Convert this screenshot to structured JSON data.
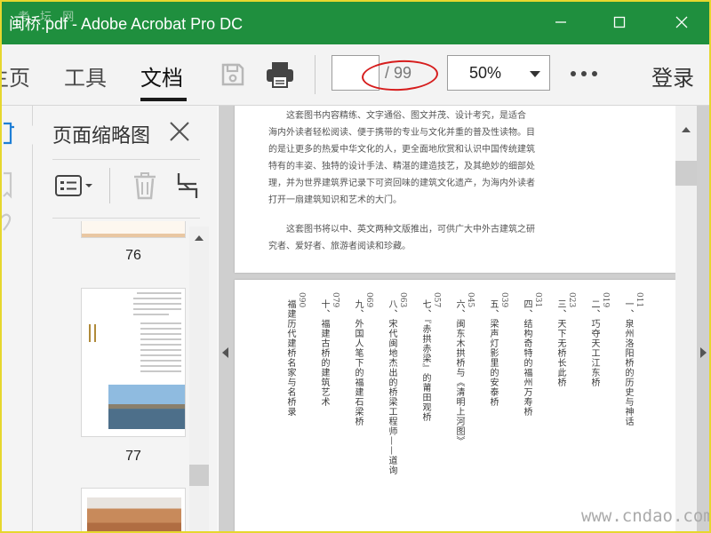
{
  "window": {
    "title": "闽桥.pdf - Adobe Acrobat Pro DC",
    "watermark": "考 坛 网"
  },
  "toolbar": {
    "tabs": [
      {
        "label": "主页"
      },
      {
        "label": "工具"
      },
      {
        "label": "文档",
        "active": true
      }
    ],
    "page_current": "",
    "page_total": "/ 99",
    "zoom": "50%",
    "login": "登录"
  },
  "thumbnail_panel": {
    "title": "页面缩略图",
    "thumbs": [
      {
        "label": "76"
      },
      {
        "label": "77"
      }
    ]
  },
  "document": {
    "page1_paragraphs": [
      "这套图书内容精练、文字通俗、图文并茂、设计考究，是适合",
      "海内外读者轻松阅读、便于携带的专业与文化并重的普及性读物。目",
      "的是让更多的热爱中华文化的人，更全面地欣赏和认识中国传统建筑",
      "特有的丰姿、独特的设计手法、精湛的建造技艺，及其绝妙的细部处",
      "理，并为世界建筑界记录下可资回味的建筑文化遗产，为海内外读者",
      "打开一扇建筑知识和艺术的大门。"
    ],
    "page1_paragraph2": [
      "这套图书将以中、英文两种文版推出，可供广大中外古建筑之研",
      "究者、爱好者、旅游者阅读和珍藏。"
    ],
    "toc": [
      {
        "num": "011",
        "title": "一、泉州洛阳桥的历史与神话"
      },
      {
        "num": "019",
        "title": "二、巧夺天工江东桥"
      },
      {
        "num": "023",
        "title": "三、天下无桥长此桥"
      },
      {
        "num": "031",
        "title": "四、结构奇特的福州万寿桥"
      },
      {
        "num": "039",
        "title": "五、梁声灯影里的安泰桥"
      },
      {
        "num": "045",
        "title": "六、闽东木拱桥与《清明上河图》"
      },
      {
        "num": "057",
        "title": "七、『赤拱赤梁』的莆田观桥"
      },
      {
        "num": "063",
        "title": "八、宋代闽地杰出的桥梁工程师——道询"
      },
      {
        "num": "069",
        "title": "九、外国人笔下的福建石梁桥"
      },
      {
        "num": "079",
        "title": "十、福建古桥的建筑艺术"
      },
      {
        "num": "090",
        "title": "福建历代建桥名家与名桥录"
      }
    ]
  },
  "site_watermark": "www.cndao.com",
  "colors": {
    "titlebar": "#1f8f3e",
    "annotation_oval": "#d61d1d",
    "frame": "#e6d72e"
  },
  "icons": [
    "save-icon",
    "print-icon",
    "more-icon",
    "thumbnail-options-icon",
    "delete-icon",
    "crop-icon",
    "close-icon",
    "minimize-icon",
    "maximize-icon"
  ]
}
